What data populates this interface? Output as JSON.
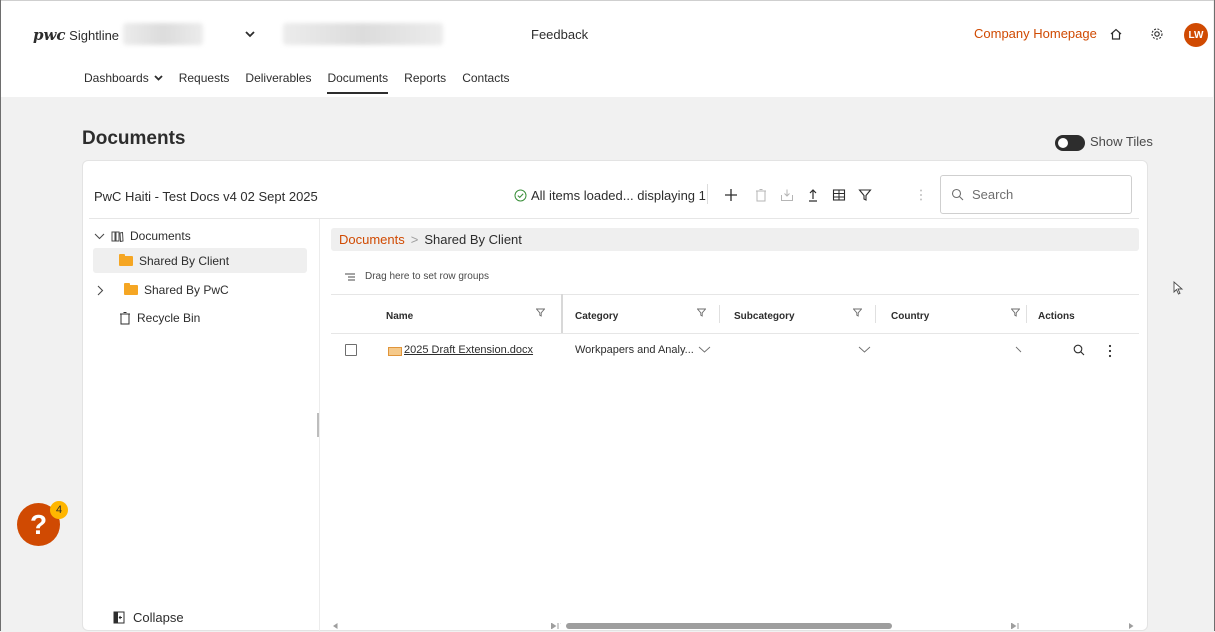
{
  "header": {
    "brand": "pwc",
    "app_name": "Sightline",
    "feedback": "Feedback",
    "company_homepage": "Company Homepage",
    "avatar_initials": "LW"
  },
  "nav": {
    "items": [
      {
        "label": "Dashboards"
      },
      {
        "label": "Requests"
      },
      {
        "label": "Deliverables"
      },
      {
        "label": "Documents"
      },
      {
        "label": "Reports"
      },
      {
        "label": "Contacts"
      }
    ],
    "active": "Documents"
  },
  "page": {
    "title": "Documents",
    "show_tiles_label": "Show Tiles"
  },
  "card": {
    "title": "PwC Haiti - Test Docs v4 02 Sept 2025",
    "status": "All items loaded... displaying 1",
    "search_placeholder": "Search"
  },
  "tree": {
    "root": "Documents",
    "items": [
      {
        "label": "Shared By Client",
        "selected": true
      },
      {
        "label": "Shared By PwC"
      },
      {
        "label": "Recycle Bin"
      }
    ],
    "collapse_label": "Collapse"
  },
  "breadcrumb": {
    "root": "Documents",
    "separator": ">",
    "current": "Shared By Client"
  },
  "grid": {
    "group_hint": "Drag here to set row groups",
    "columns": [
      "Name",
      "Category",
      "Subcategory",
      "Country",
      "Actions"
    ],
    "rows": [
      {
        "name": "2025 Draft Extension.docx",
        "category": "Workpapers and Analy...",
        "subcategory": "",
        "country": ""
      }
    ]
  },
  "help": {
    "glyph": "?",
    "badge_count": "4"
  },
  "colors": {
    "accent": "#d04a02",
    "folder": "#f5a623",
    "badge": "#ffb600"
  }
}
